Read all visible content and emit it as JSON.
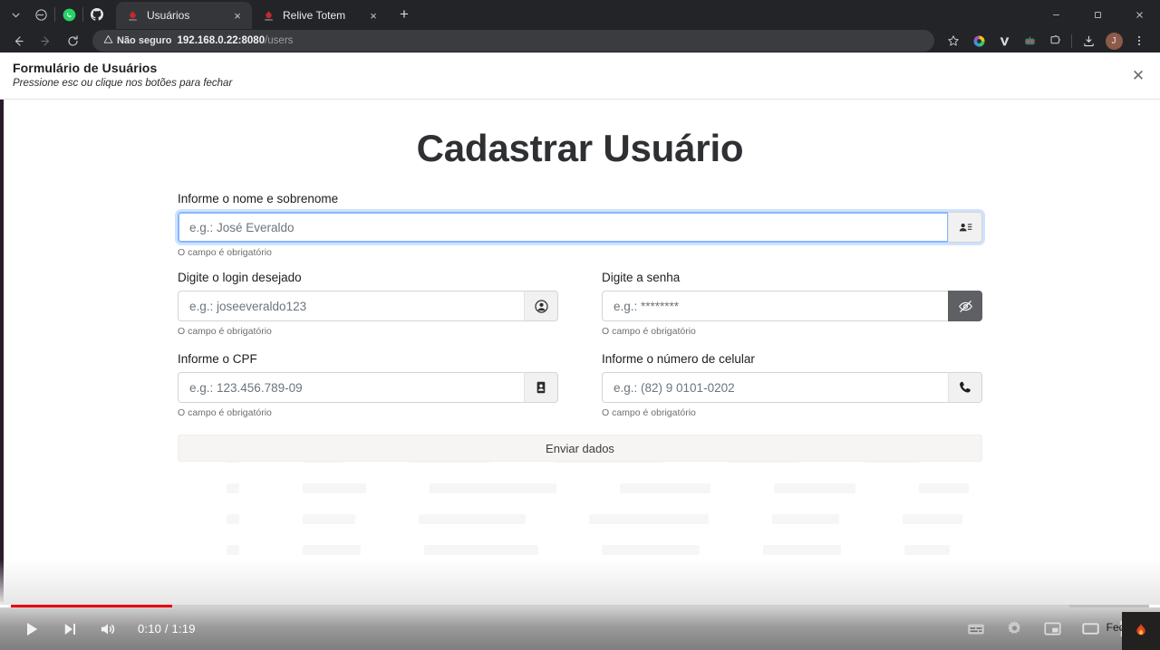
{
  "browser": {
    "pinned_tabs": [
      {
        "name": "menu-chevron",
        "icon": "chevron-down-icon"
      },
      {
        "name": "pinned-mask",
        "icon": "mask-icon"
      },
      {
        "name": "pinned-whatsapp",
        "icon": "whatsapp-icon"
      },
      {
        "name": "pinned-github",
        "icon": "github-icon"
      }
    ],
    "tabs": [
      {
        "title": "Usuários",
        "active": true,
        "favicon": "relive-icon",
        "close_label": "×"
      },
      {
        "title": "Relive Totem",
        "active": false,
        "favicon": "relive-icon",
        "close_label": "×"
      }
    ],
    "new_tab_label": "+",
    "window_controls": {
      "minimize": "—",
      "maximize": "❐",
      "close": "✕"
    },
    "nav": {
      "back": "←",
      "forward": "→",
      "reload": "⟳"
    },
    "omnibox": {
      "security_label": "Não seguro",
      "security_icon": "warning-triangle-icon",
      "url_host": "192.168.0.22",
      "url_port": ":8080",
      "url_path": "/users"
    },
    "omnibox_icons": [
      {
        "name": "bookmark-star-icon"
      },
      {
        "name": "color-wheel-extension-icon"
      },
      {
        "name": "v-extension-icon"
      },
      {
        "name": "robot-extension-icon"
      },
      {
        "name": "puzzle-extensions-icon"
      },
      {
        "name": "download-icon"
      },
      {
        "name": "profile-avatar",
        "label": "J"
      },
      {
        "name": "chrome-more-menu-icon",
        "label": "⋮"
      }
    ]
  },
  "modal": {
    "title": "Formulário de Usuários",
    "subtitle": "Pressione esc ou clique nos botões para fechar",
    "close_label": "✕"
  },
  "form": {
    "heading": "Cadastrar Usuário",
    "helper_required": "O campo é obrigatório",
    "submit_label": "Enviar dados",
    "fields": [
      {
        "id": "fullname",
        "label": "Informe o nome e sobrenome",
        "placeholder": "e.g.: José Everaldo",
        "value": "",
        "helper": "O campo é obrigatório",
        "icon": "contact-card-icon",
        "focused": true
      },
      {
        "id": "login",
        "label": "Digite o login desejado",
        "placeholder": "e.g.: joseeveraldo123",
        "value": "",
        "helper": "O campo é obrigatório",
        "icon": "user-circle-icon",
        "focused": false
      },
      {
        "id": "password",
        "label": "Digite a senha",
        "placeholder": "e.g.: ********",
        "value": "",
        "helper": "O campo é obrigatório",
        "icon": "eye-off-icon",
        "focused": false
      },
      {
        "id": "cpf",
        "label": "Informe o CPF",
        "placeholder": "e.g.: 123.456.789-09",
        "value": "",
        "helper": "O campo é obrigatório",
        "icon": "id-card-icon",
        "focused": false
      },
      {
        "id": "phone",
        "label": "Informe o número de celular",
        "placeholder": "e.g.: (82) 9 0101-0202",
        "value": "",
        "helper": "O campo é obrigatório",
        "icon": "phone-icon",
        "focused": false
      }
    ]
  },
  "video": {
    "current_time": "0:10",
    "duration": "1:19",
    "time_display": "0:10 / 1:19",
    "progress_percent": 14.2,
    "buffered_percent": 93,
    "controls_left": [
      {
        "name": "play-button",
        "icon": "play-icon"
      },
      {
        "name": "next-button",
        "icon": "next-track-icon"
      },
      {
        "name": "volume-button",
        "icon": "volume-icon"
      }
    ],
    "controls_right": [
      {
        "name": "captions-button",
        "icon": "captions-icon"
      },
      {
        "name": "settings-button",
        "icon": "gear-icon"
      },
      {
        "name": "miniplayer-button",
        "icon": "miniplayer-icon"
      },
      {
        "name": "theater-button",
        "icon": "theater-mode-icon"
      },
      {
        "name": "fullscreen-button",
        "icon": "fullscreen-icon"
      }
    ],
    "overlay_label": "Fechar",
    "corner_icon": "flame-app-icon"
  },
  "colors": {
    "accent_red": "#e8000d",
    "focus_blue": "#86b7fe",
    "chrome_dark": "#232427",
    "tab_active": "#35363a",
    "addon_dark": "#5e6063"
  }
}
